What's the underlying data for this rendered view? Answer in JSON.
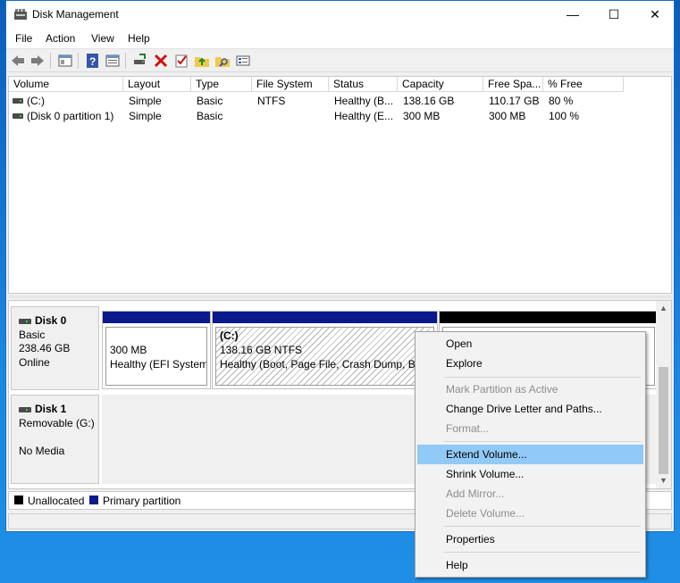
{
  "window": {
    "title": "Disk Management",
    "minimize": "—",
    "maximize": "☐",
    "close": "✕"
  },
  "menubar": [
    "File",
    "Action",
    "View",
    "Help"
  ],
  "toolbar_icons": [
    "back-arrow-icon",
    "forward-arrow-icon",
    "console-tree-icon",
    "help-icon",
    "properties-icon",
    "connect-drive-icon",
    "delete-icon",
    "check-icon",
    "folder-up-icon",
    "folder-search-icon",
    "list-view-icon"
  ],
  "volume_list": {
    "columns": [
      "Volume",
      "Layout",
      "Type",
      "File System",
      "Status",
      "Capacity",
      "Free Spa...",
      "% Free"
    ],
    "rows": [
      [
        "(C:)",
        "Simple",
        "Basic",
        "NTFS",
        "Healthy (B...",
        "138.16 GB",
        "110.17 GB",
        "80 %"
      ],
      [
        "(Disk 0 partition 1)",
        "Simple",
        "Basic",
        "",
        "Healthy (E...",
        "300 MB",
        "300 MB",
        "100 %"
      ]
    ]
  },
  "disks": [
    {
      "name": "Disk 0",
      "lines": [
        "Basic",
        "238.46 GB",
        "Online"
      ],
      "partitions": [
        {
          "size": "300 MB",
          "status": "Healthy (EFI System"
        },
        {
          "label": "(C:)",
          "size": "138.16 GB NTFS",
          "status": "Healthy (Boot, Page File, Crash Dump, Bas"
        },
        {
          "size": "",
          "status": ""
        }
      ]
    },
    {
      "name": "Disk 1",
      "lines": [
        "Removable (G:)",
        "",
        "No Media"
      ]
    }
  ],
  "legend": [
    {
      "label": "Unallocated",
      "color": "#000000"
    },
    {
      "label": "Primary partition",
      "color": "#0a1a8c"
    }
  ],
  "colors": {
    "primary_partition": "#0a1a8c",
    "unallocated": "#000000",
    "menu_highlight": "#91c9f7"
  },
  "context_menu": {
    "items": [
      {
        "label": "Open",
        "enabled": true
      },
      {
        "label": "Explore",
        "enabled": true
      },
      {
        "label": "Mark Partition as Active",
        "enabled": false
      },
      {
        "label": "Change Drive Letter and Paths...",
        "enabled": true
      },
      {
        "label": "Format...",
        "enabled": false
      },
      {
        "label": "Extend Volume...",
        "enabled": true,
        "highlighted": true
      },
      {
        "label": "Shrink Volume...",
        "enabled": true
      },
      {
        "label": "Add Mirror...",
        "enabled": false
      },
      {
        "label": "Delete Volume...",
        "enabled": false
      },
      {
        "label": "Properties",
        "enabled": true
      },
      {
        "label": "Help",
        "enabled": true
      }
    ]
  }
}
